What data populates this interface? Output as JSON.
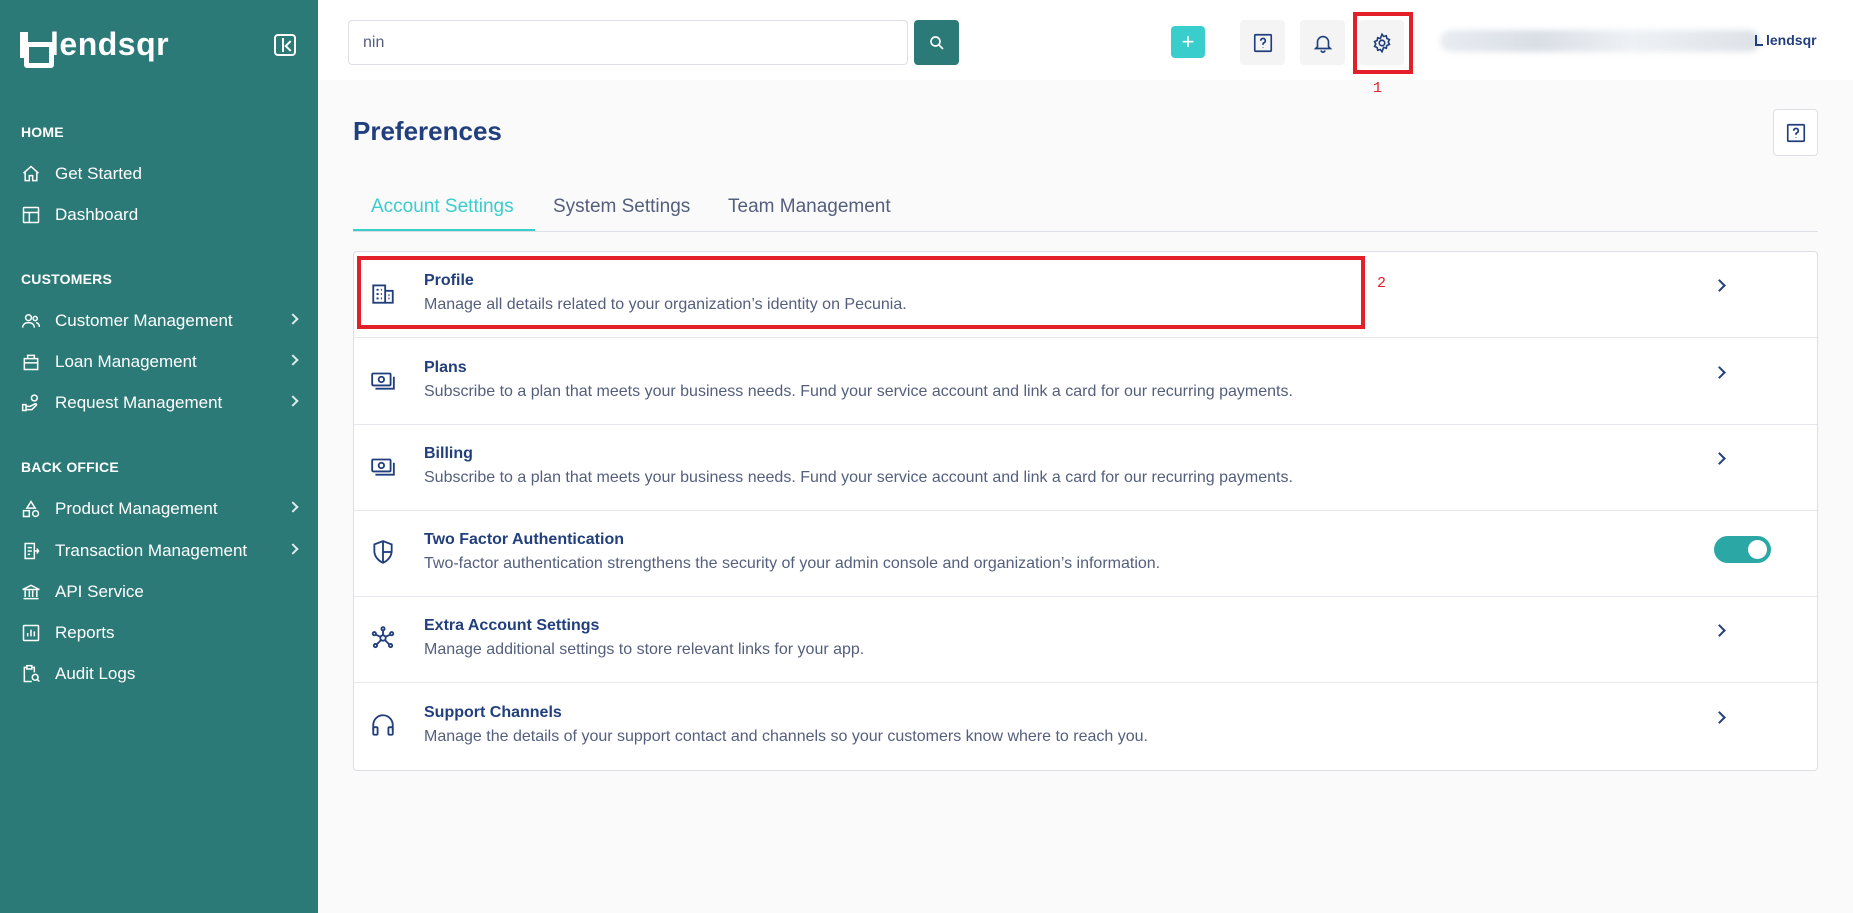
{
  "brand": {
    "name": "lendsqr"
  },
  "sidebar": {
    "sections": [
      {
        "title": "HOME",
        "items": [
          {
            "label": "Get Started",
            "icon": "home-icon",
            "has_submenu": false
          },
          {
            "label": "Dashboard",
            "icon": "dashboard-icon",
            "has_submenu": false
          }
        ]
      },
      {
        "title": "CUSTOMERS",
        "items": [
          {
            "label": "Customer Management",
            "icon": "users-icon",
            "has_submenu": true
          },
          {
            "label": "Loan Management",
            "icon": "loan-icon",
            "has_submenu": true
          },
          {
            "label": "Request Management",
            "icon": "request-icon",
            "has_submenu": true
          }
        ]
      },
      {
        "title": "BACK OFFICE",
        "items": [
          {
            "label": "Product Management",
            "icon": "shapes-icon",
            "has_submenu": true
          },
          {
            "label": "Transaction Management",
            "icon": "transaction-icon",
            "has_submenu": true
          },
          {
            "label": "API Service",
            "icon": "bank-icon",
            "has_submenu": false
          },
          {
            "label": "Reports",
            "icon": "reports-icon",
            "has_submenu": false
          },
          {
            "label": "Audit Logs",
            "icon": "audit-icon",
            "has_submenu": false
          }
        ]
      }
    ]
  },
  "topbar": {
    "search_value": "nin",
    "add_label": "+",
    "org_logo_text": "lendsqr"
  },
  "annotations": {
    "label_1": "1",
    "label_2": "2"
  },
  "page": {
    "title": "Preferences",
    "tabs": [
      "Account Settings",
      "System Settings",
      "Team Management"
    ],
    "active_tab": 0,
    "rows": [
      {
        "title": "Profile",
        "description": "Manage all details related to your organization’s identity on Pecunia.",
        "icon": "building-icon",
        "control": "chevron"
      },
      {
        "title": "Plans",
        "description": "Subscribe to a plan that meets your business needs. Fund your service account and link a card for our recurring payments.",
        "icon": "money-icon",
        "control": "chevron"
      },
      {
        "title": "Billing",
        "description": "Subscribe to a plan that meets your business needs. Fund your service account and link a card for our recurring payments.",
        "icon": "money-icon",
        "control": "chevron"
      },
      {
        "title": "Two Factor Authentication",
        "description": "Two-factor authentication strengthens the security of your admin console and organization’s information.",
        "icon": "shield-icon",
        "control": "toggle",
        "toggle_on": true
      },
      {
        "title": "Extra Account Settings",
        "description": "Manage additional settings to store relevant links for your app.",
        "icon": "network-icon",
        "control": "chevron"
      },
      {
        "title": "Support Channels",
        "description": "Manage the details of your support contact and channels so your customers know where to reach you.",
        "icon": "headphones-icon",
        "control": "chevron"
      }
    ]
  },
  "colors": {
    "sidebar": "#2b7a78",
    "accent": "#39cdcc",
    "primary_text": "#213f7d",
    "annotation": "#e3202a"
  }
}
